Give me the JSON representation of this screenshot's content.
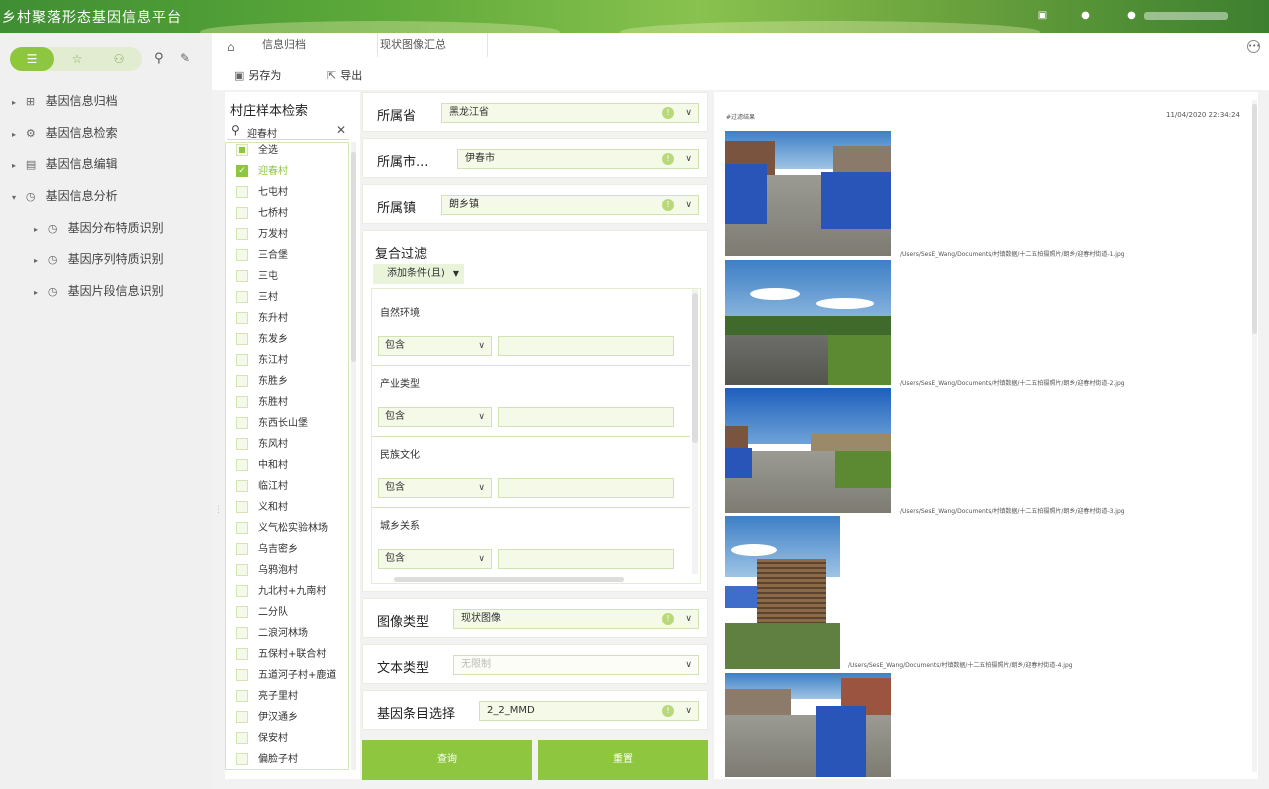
{
  "header": {
    "title": "乡村聚落形态基因信息平台",
    "icons": [
      "book-icon",
      "bell-icon",
      "user-icon"
    ]
  },
  "sidebar": {
    "tabs": [
      "list-icon",
      "star-icon",
      "share-icon"
    ],
    "items": [
      {
        "label": "基因信息归档",
        "icon": "grid-icon",
        "expanded": false
      },
      {
        "label": "基因信息检索",
        "icon": "search-gear-icon",
        "expanded": false
      },
      {
        "label": "基因信息编辑",
        "icon": "edit-icon",
        "expanded": false
      },
      {
        "label": "基因信息分析",
        "icon": "clock-icon",
        "expanded": true
      },
      {
        "label": "基因分布特质识别",
        "icon": "clock-icon",
        "level": 2
      },
      {
        "label": "基因序列特质识别",
        "icon": "clock-icon",
        "level": 2
      },
      {
        "label": "基因片段信息识别",
        "icon": "clock-icon",
        "level": 2
      }
    ]
  },
  "tabs": [
    {
      "label": "信息归档"
    },
    {
      "label": "现状图像汇总"
    }
  ],
  "toolbar": {
    "save_as": "另存为",
    "export": "导出"
  },
  "village": {
    "title": "村庄样本检索",
    "search_value": "迎春村",
    "select_all": "全选",
    "items": [
      {
        "label": "迎春村",
        "checked": true
      },
      {
        "label": "七屯村"
      },
      {
        "label": "七桥村"
      },
      {
        "label": "万发村"
      },
      {
        "label": "三合堡"
      },
      {
        "label": "三屯"
      },
      {
        "label": "三村"
      },
      {
        "label": "东升村"
      },
      {
        "label": "东发乡"
      },
      {
        "label": "东江村"
      },
      {
        "label": "东胜乡"
      },
      {
        "label": "东胜村"
      },
      {
        "label": "东西长山堡"
      },
      {
        "label": "东风村"
      },
      {
        "label": "中和村"
      },
      {
        "label": "临江村"
      },
      {
        "label": "义和村"
      },
      {
        "label": "义气松实验林场"
      },
      {
        "label": "乌吉密乡"
      },
      {
        "label": "乌鸦泡村"
      },
      {
        "label": "九北村+九南村"
      },
      {
        "label": "二分队"
      },
      {
        "label": "二浪河林场"
      },
      {
        "label": "五保村+联合村"
      },
      {
        "label": "五道河子村+鹿道"
      },
      {
        "label": "亮子里村"
      },
      {
        "label": "伊汉通乡"
      },
      {
        "label": "保安村"
      },
      {
        "label": "偏脸子村"
      }
    ]
  },
  "filters": {
    "province": {
      "label": "所属省",
      "value": "黑龙江省"
    },
    "city": {
      "label": "所属市...",
      "value": "伊春市"
    },
    "town": {
      "label": "所属镇",
      "value": "朗乡镇"
    },
    "compound": {
      "title": "复合过滤",
      "add_label": "添加条件(且)",
      "conditions": [
        {
          "name": "自然环境",
          "op": "包含"
        },
        {
          "name": "产业类型",
          "op": "包含"
        },
        {
          "name": "民族文化",
          "op": "包含"
        },
        {
          "name": "城乡关系",
          "op": "包含"
        }
      ]
    },
    "image_type": {
      "label": "图像类型",
      "value": "现状图像"
    },
    "text_type": {
      "label": "文本类型",
      "value": "无限制"
    },
    "gene": {
      "label": "基因条目选择",
      "value": "2_2_MMD"
    },
    "query": "查询",
    "reset": "重置"
  },
  "results": {
    "label": "#过滤结果",
    "time": "11/04/2020 22:34:24",
    "images": [
      {
        "path": "/Users/SesE_Wang/Documents/村镇数据/十二五拍摄照片/朗乡/迎春村街道-1.jpg"
      },
      {
        "path": "/Users/SesE_Wang/Documents/村镇数据/十二五拍摄照片/朗乡/迎春村街道-2.jpg"
      },
      {
        "path": "/Users/SesE_Wang/Documents/村镇数据/十二五拍摄照片/朗乡/迎春村街道-3.jpg"
      },
      {
        "path": "/Users/SesE_Wang/Documents/村镇数据/十二五拍摄照片/朗乡/迎春村街道-4.jpg"
      },
      {
        "path": ""
      }
    ]
  }
}
